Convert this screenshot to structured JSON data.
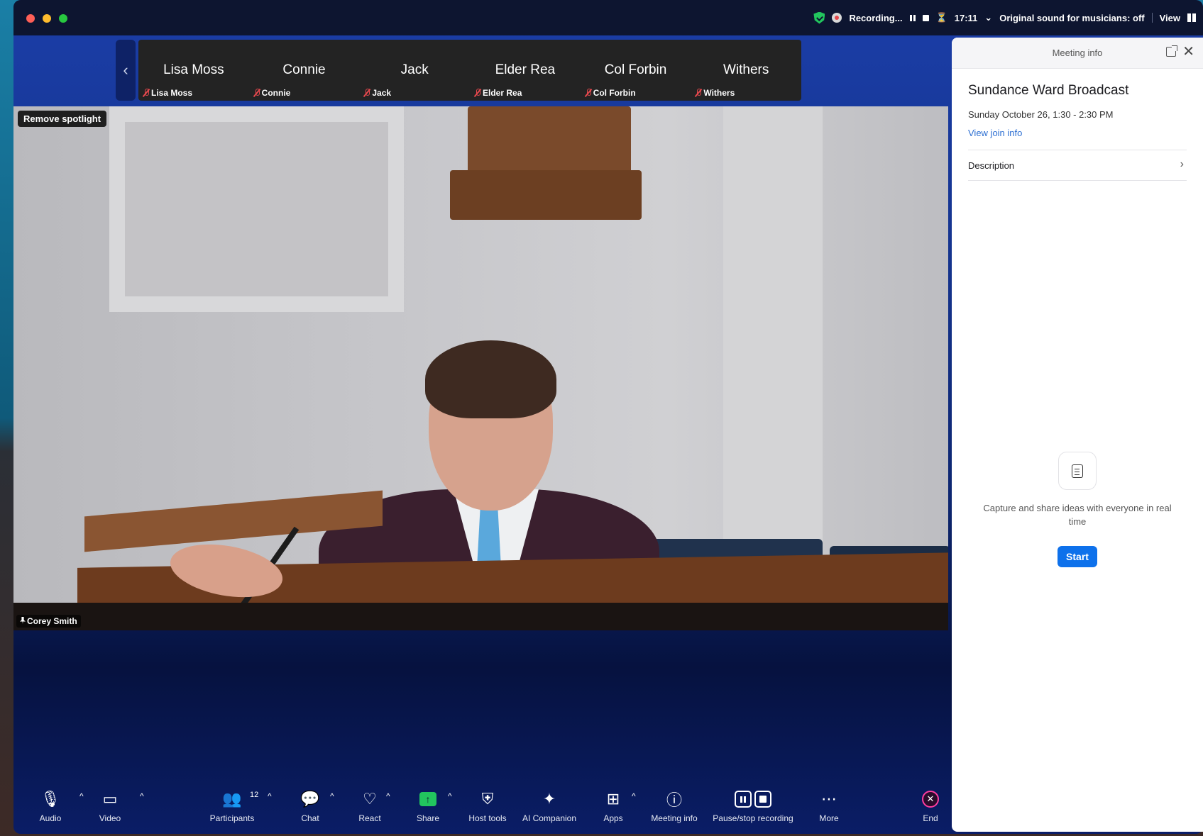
{
  "status_bar": {
    "recording_text": "Recording...",
    "timer": "17:11",
    "sound_text": "Original sound for musicians: off",
    "view_label": "View"
  },
  "strip": {
    "participants": [
      {
        "display": "Lisa Moss",
        "label": "Lisa Moss"
      },
      {
        "display": "Connie",
        "label": "Connie"
      },
      {
        "display": "Jack",
        "label": "Jack"
      },
      {
        "display": "Elder Rea",
        "label": "Elder Rea"
      },
      {
        "display": "Col Forbin",
        "label": "Col Forbin"
      },
      {
        "display": "Withers",
        "label": "Withers"
      }
    ]
  },
  "video": {
    "remove_spotlight_label": "Remove spotlight",
    "speaker_name": "Corey Smith"
  },
  "toolbar": {
    "audio": "Audio",
    "video": "Video",
    "participants": "Participants",
    "participants_count": "12",
    "chat": "Chat",
    "react": "React",
    "share": "Share",
    "host_tools": "Host tools",
    "ai_companion": "AI Companion",
    "apps": "Apps",
    "meeting_info": "Meeting info",
    "pause_stop": "Pause/stop recording",
    "more": "More",
    "end": "End"
  },
  "panel": {
    "title": "Meeting info",
    "meeting_name": "Sundance Ward Broadcast",
    "meeting_time": "Sunday October 26, 1:30 - 2:30 PM",
    "join_link": "View join info",
    "description_label": "Description",
    "capture_text": "Capture and share ideas with everyone in real time",
    "start_label": "Start"
  },
  "colors": {
    "accent_blue": "#0e71eb",
    "link_blue": "#2d6fd2",
    "share_green": "#22c55e",
    "end_pink": "#ff3da0",
    "muted_red": "#e5484d"
  }
}
